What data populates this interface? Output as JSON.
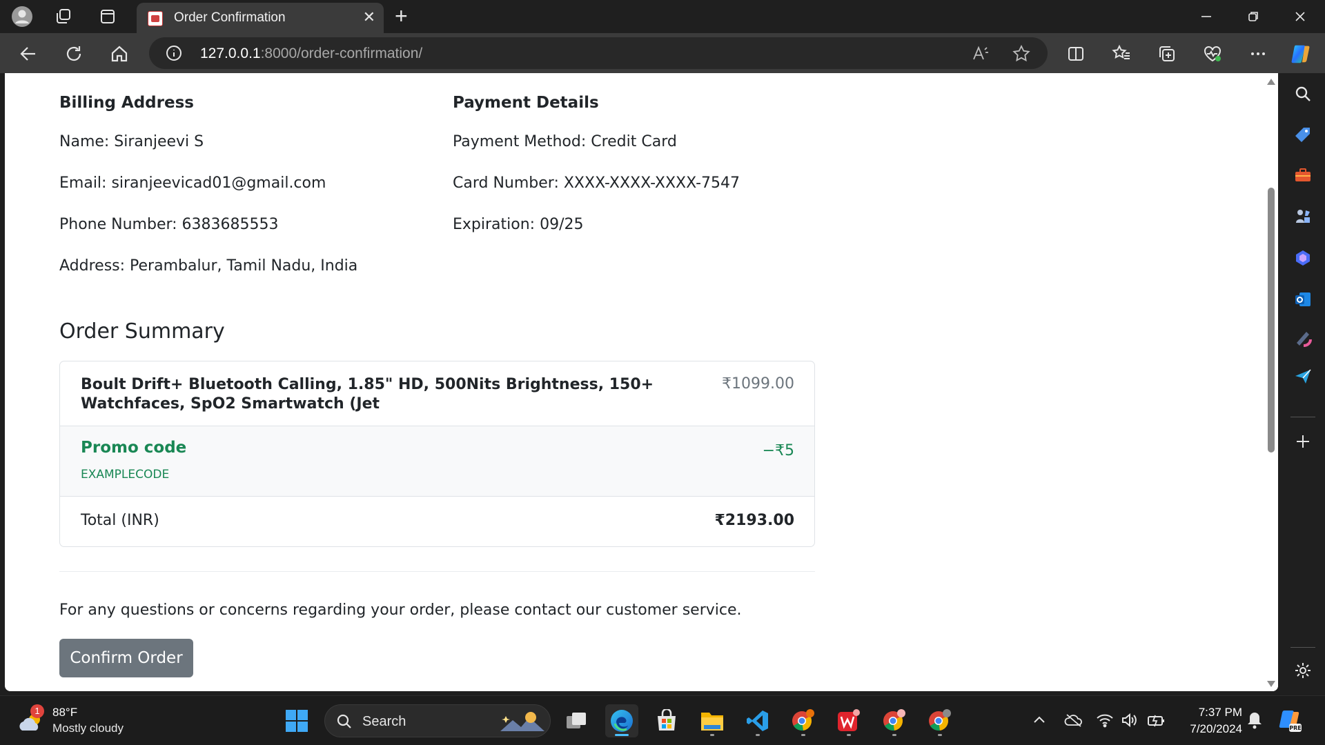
{
  "browser": {
    "tab_title": "Order Confirmation",
    "url_host": "127.0.0.1",
    "url_path": ":8000/order-confirmation/"
  },
  "billing": {
    "heading": "Billing Address",
    "name": "Name: Siranjeevi S",
    "email": "Email: siranjeevicad01@gmail.com",
    "phone": "Phone Number: 6383685553",
    "address": "Address: Perambalur, Tamil Nadu, India"
  },
  "payment": {
    "heading": "Payment Details",
    "method": "Payment Method: Credit Card",
    "card": "Card Number: XXXX-XXXX-XXXX-7547",
    "expiration": "Expiration: 09/25"
  },
  "summary": {
    "title": "Order Summary",
    "product_name": "Boult Drift+ Bluetooth Calling, 1.85\" HD, 500Nits Brightness, 150+ Watchfaces, SpO2 Smartwatch (Jet",
    "product_price": "₹1099.00",
    "promo_title": "Promo code",
    "promo_code": "EXAMPLECODE",
    "promo_amount": "−₹5",
    "total_label": "Total (INR)",
    "total_value": "₹2193.00"
  },
  "contact_text": "For any questions or concerns regarding your order, please contact our customer service.",
  "confirm_button": "Confirm Order",
  "taskbar": {
    "weather_temp": "88°F",
    "weather_condition": "Mostly cloudy",
    "weather_badge": "1",
    "search_label": "Search",
    "time": "7:37 PM",
    "date": "7/20/2024"
  },
  "colors": {
    "accent_green": "#198754",
    "button_gray": "#6c757d",
    "text_dark": "#212529"
  }
}
